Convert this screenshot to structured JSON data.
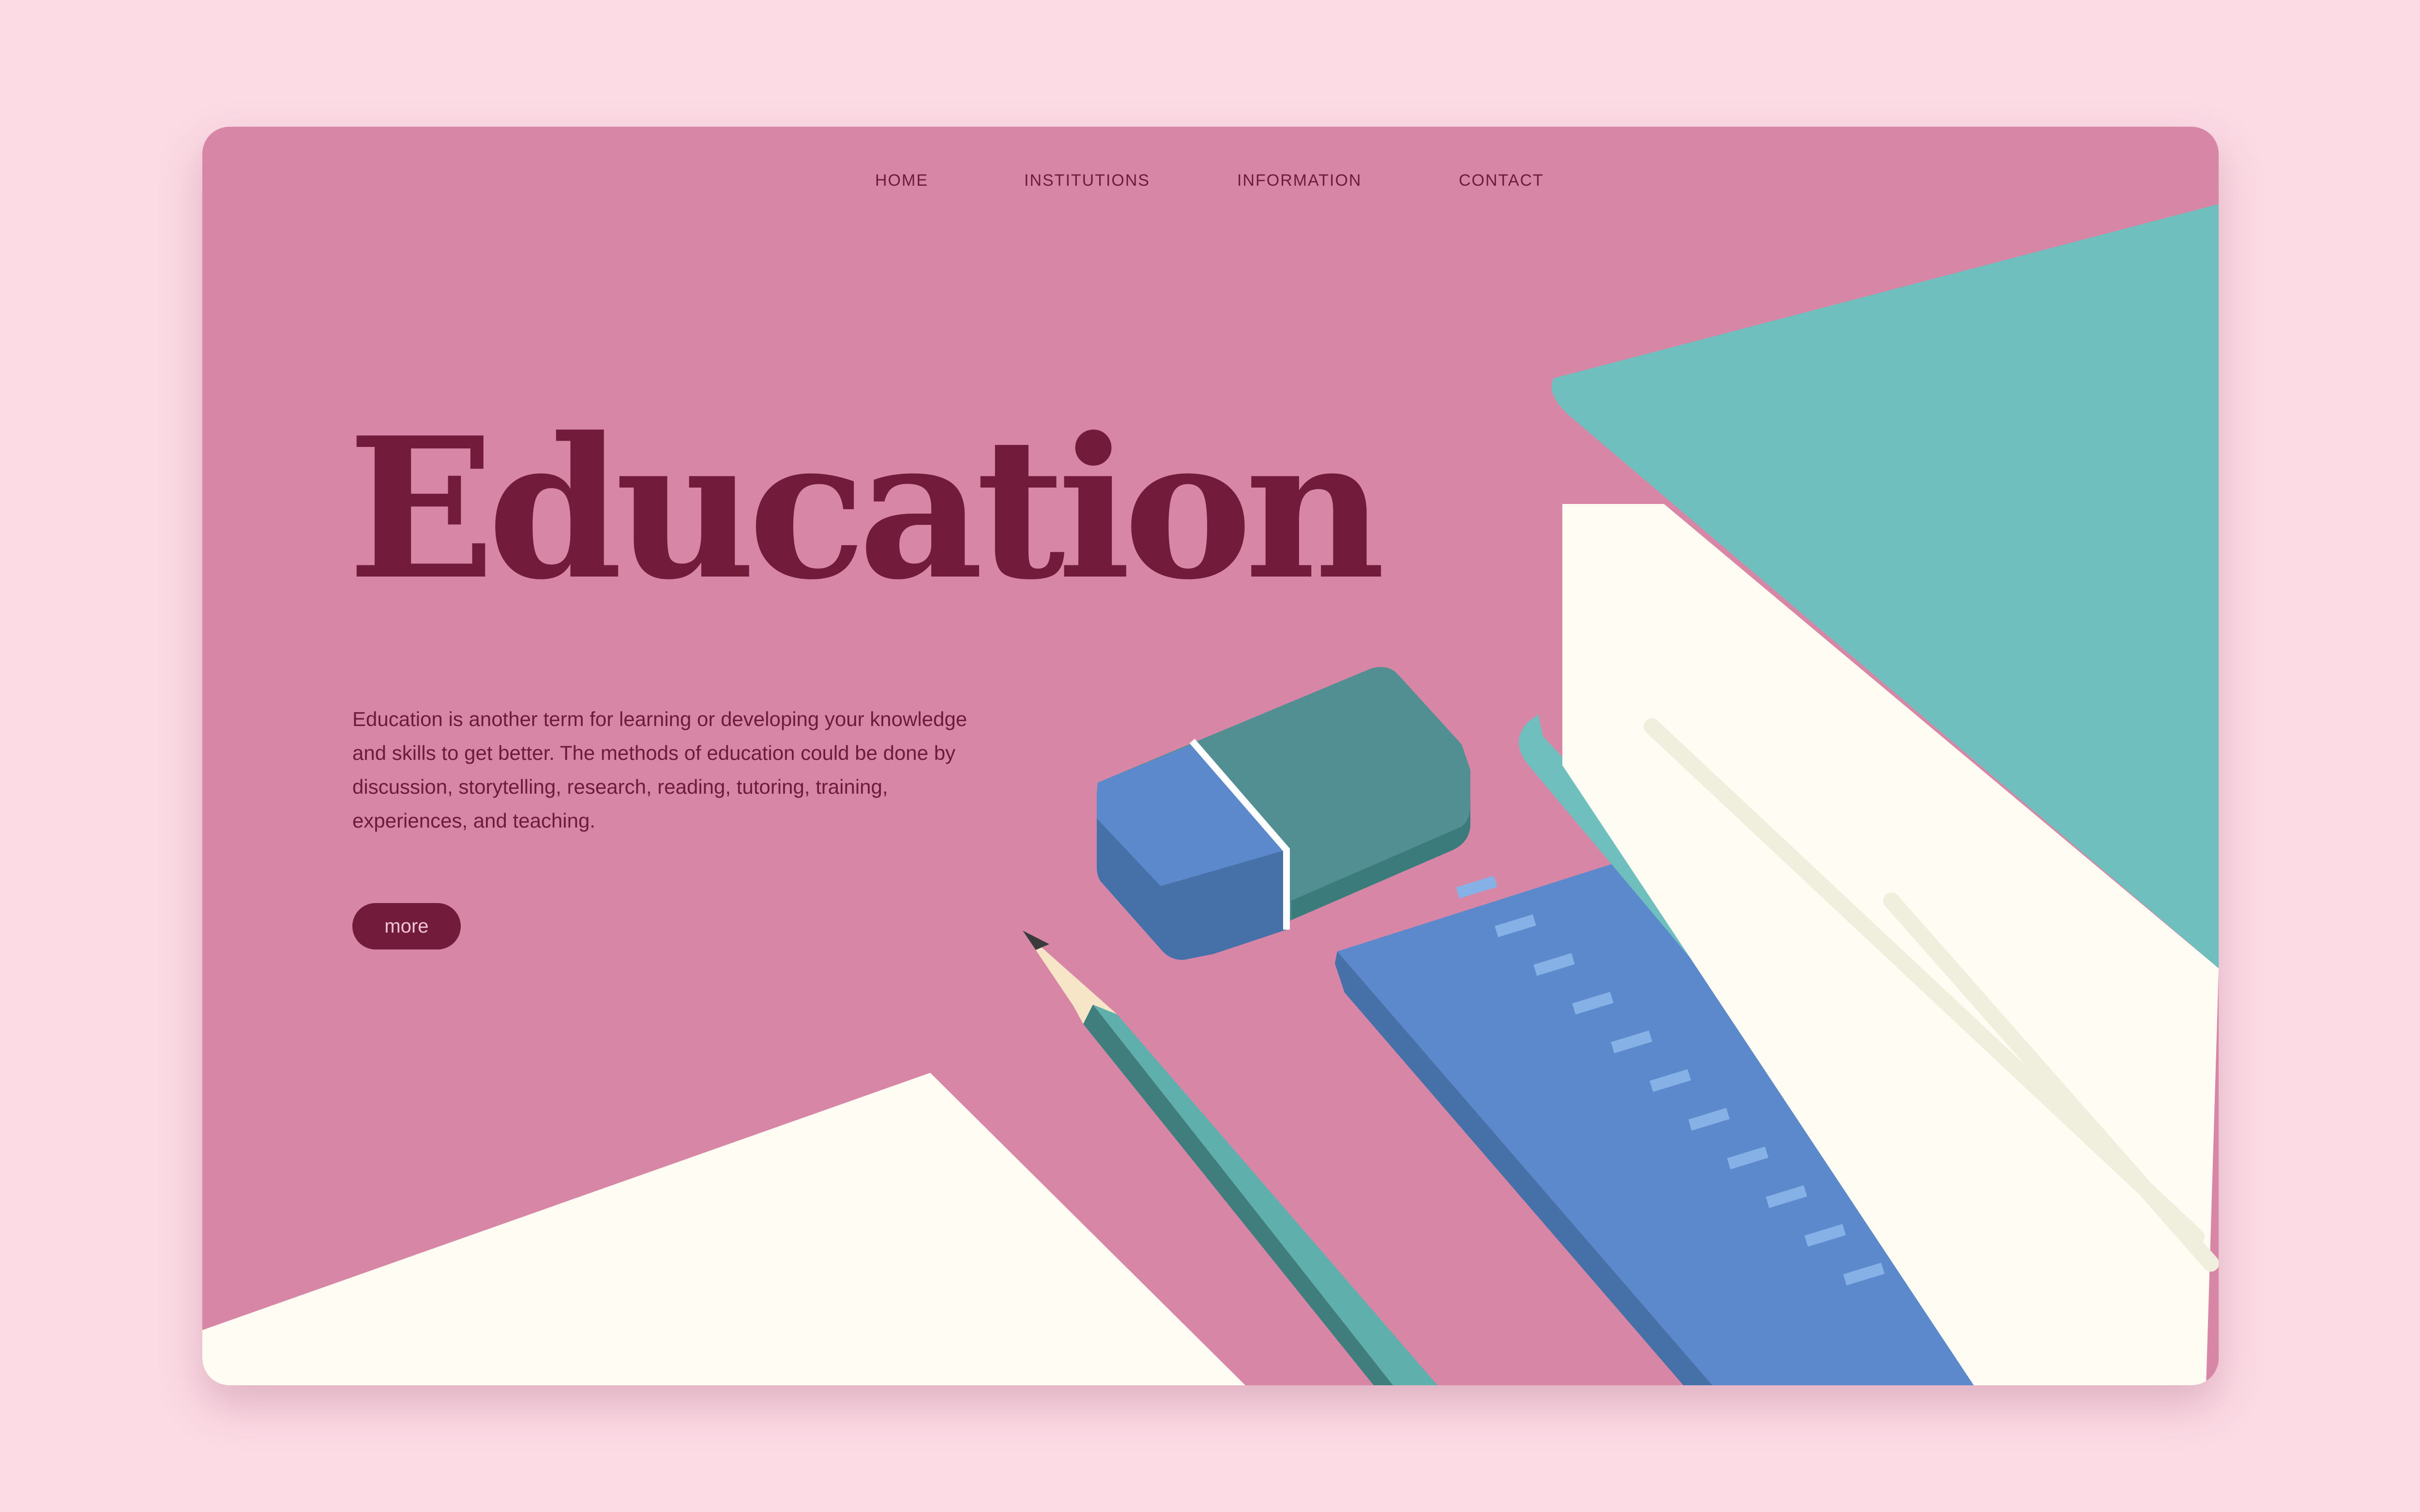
{
  "nav": {
    "items": [
      {
        "label": "HOME"
      },
      {
        "label": "INSTITUTIONS"
      },
      {
        "label": "INFORMATION"
      },
      {
        "label": "CONTACT"
      }
    ]
  },
  "hero": {
    "title": "Education",
    "description": "Education is another term for learning or developing your knowledge and skills to get better. The methods of education could be done by discussion, storytelling, research, reading, tutoring, training, experiences, and teaching.",
    "button_label": "more"
  },
  "colors": {
    "page_background": "#fcdbe5",
    "card_background": "#d886a6",
    "accent_dark": "#721b3b",
    "book_teal": "#6fbfbf",
    "paper_cream": "#fffcf3",
    "ruler_blue": "#5b89cc",
    "eraser_teal": "#528f93"
  },
  "illustration": {
    "icons": [
      "book-icon",
      "eraser-icon",
      "pencil-icon",
      "ruler-icon",
      "paper-sheet-icon"
    ]
  }
}
